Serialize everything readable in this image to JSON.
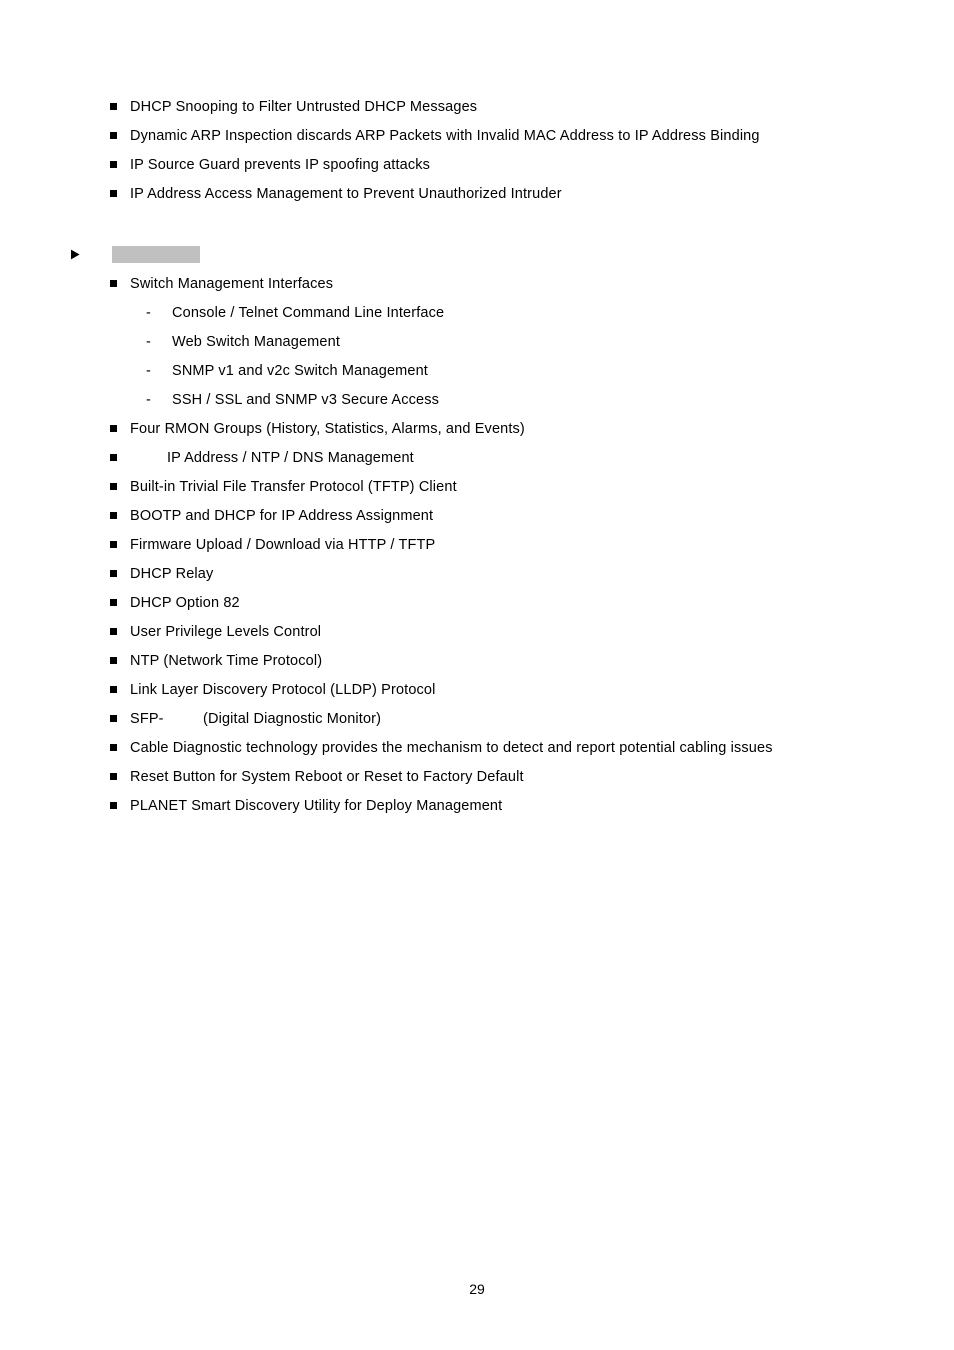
{
  "page": {
    "number": "29",
    "background_color": "#ffffff",
    "text_color": "#000000"
  },
  "markers": {
    "square_bullet": "■",
    "dash_bullet": "-",
    "arrow_bullet": "➢"
  },
  "redaction": {
    "color": "#c0c0c0",
    "label": ""
  },
  "security_features": {
    "items": [
      {
        "text": "DHCP Snooping to Filter Untrusted DHCP Messages"
      },
      {
        "text": "Dynamic ARP Inspection discards ARP Packets with Invalid MAC Address to IP Address Binding"
      },
      {
        "text": "IP Source Guard prevents IP spoofing attacks"
      },
      {
        "text": "IP Address Access Management to Prevent Unauthorized Intruder"
      }
    ]
  },
  "management_section": {
    "heading": "",
    "switch_management_interfaces": {
      "text": "Switch Management Interfaces",
      "sub_items": [
        {
          "text": "Console / Telnet Command Line Interface"
        },
        {
          "text": "Web Switch Management"
        },
        {
          "text": "SNMP v1 and v2c Switch Management"
        },
        {
          "text": "SSH / SSL and SNMP v3 Secure Access"
        }
      ]
    },
    "items": [
      {
        "text": "Four RMON Groups (History, Statistics, Alarms, and Events)"
      },
      {
        "text": "IP Address / NTP / DNS Management"
      },
      {
        "text": "Built-in Trivial File Transfer Protocol (TFTP) Client"
      },
      {
        "text": "BOOTP and DHCP for IP Address Assignment"
      },
      {
        "text": "Firmware Upload / Download via HTTP / TFTP"
      },
      {
        "text": "DHCP Relay"
      },
      {
        "text": "DHCP Option 82"
      },
      {
        "text": "User Privilege Levels Control"
      },
      {
        "text": "NTP (Network Time Protocol)"
      },
      {
        "text": "Link Layer Discovery Protocol (LLDP) Protocol"
      }
    ],
    "sfp_item": {
      "prefix": "SFP-",
      "suffix": "(Digital Diagnostic Monitor)"
    },
    "trailing_items": [
      {
        "text": "Cable Diagnostic technology provides the mechanism to detect and report potential cabling issues"
      },
      {
        "text": "Reset Button for System Reboot or Reset to Factory Default"
      },
      {
        "text": "PLANET Smart Discovery Utility for Deploy Management"
      }
    ]
  }
}
